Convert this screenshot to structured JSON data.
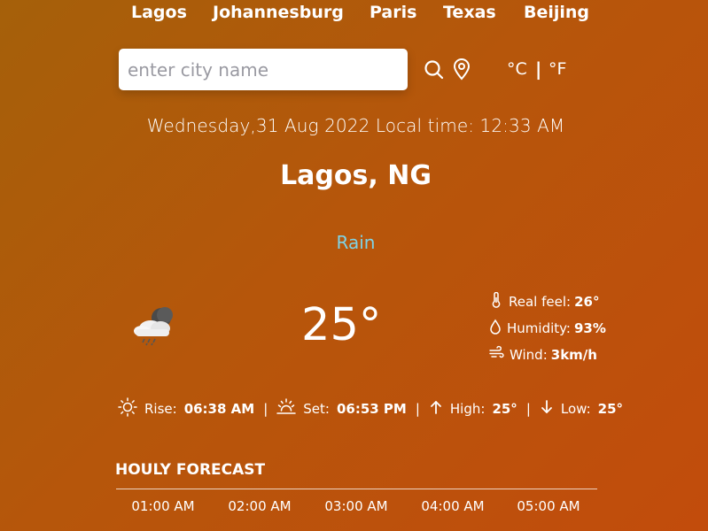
{
  "nav": {
    "cities": [
      "Lagos",
      "Johannesburg",
      "Paris",
      "Texas",
      "Beijing"
    ]
  },
  "search": {
    "placeholder": "enter city name",
    "value": "",
    "search_icon": "search-icon",
    "location_icon": "location-pin-icon"
  },
  "units": {
    "celsius": "°C",
    "separator": "|",
    "fahrenheit": "°F"
  },
  "date_time": "Wednesday,31 Aug 2022 Local time: 12:33 AM",
  "location": "Lagos, NG",
  "condition": "Rain",
  "condition_color": "#7fd3e6",
  "weather_icon": "rain-cloud-night-icon",
  "temperature": "25°",
  "details": {
    "real_feel": {
      "label": "Real feel:",
      "value": "26°",
      "icon": "thermometer-icon"
    },
    "humidity": {
      "label": "Humidity:",
      "value": "93%",
      "icon": "droplet-icon"
    },
    "wind": {
      "label": "Wind:",
      "value": "3km/h",
      "icon": "wind-icon"
    }
  },
  "sun": {
    "rise_label": "Rise:",
    "rise_value": "06:38 AM",
    "set_label": "Set:",
    "set_value": "06:53 PM",
    "high_label": "High:",
    "high_value": "25°",
    "low_label": "Low:",
    "low_value": "25°",
    "separator": "|"
  },
  "hourly": {
    "title": "HOULY FORECAST",
    "hours": [
      "01:00 AM",
      "02:00 AM",
      "03:00 AM",
      "04:00 AM",
      "05:00 AM"
    ]
  },
  "colors": {
    "background_start": "#a5600a",
    "background_end": "#c24c0c",
    "text": "#ffffff"
  }
}
